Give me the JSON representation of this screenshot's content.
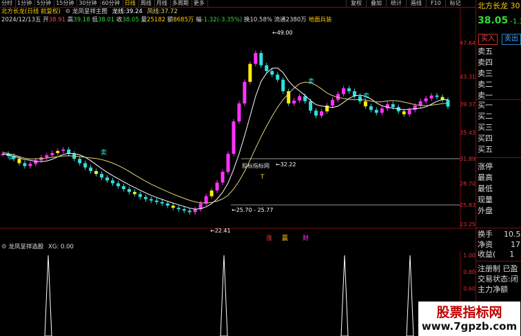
{
  "toolbar": {
    "periods": [
      "分时",
      "1分钟",
      "5分钟",
      "15分钟",
      "30分钟",
      "60分钟",
      "日线",
      "周线",
      "月线",
      "多周期",
      "更多"
    ],
    "active_index": 6,
    "right_buttons": [
      "复权",
      "叠加",
      "统计",
      "画线",
      "F10",
      "标记"
    ]
  },
  "header": {
    "title_line": "北方长龙(日线 前复权)",
    "indicator_name": "龙凤呈祥主图",
    "long_line_label": "龙线:",
    "long_line_value": "39.24",
    "phoenix_label": "凤线:",
    "phoenix_value": "37.72",
    "date": "2024/12/13五",
    "open_label": "开",
    "open_value": "38.91",
    "high_label": "高",
    "high_value": "39.18",
    "low_label": "低",
    "low_value": "38.01",
    "close_label": "收",
    "close_value": "38.05",
    "volume_label": "量",
    "volume_value": "25182",
    "amount_label": "额",
    "amount_value": "8685万",
    "change_label": "幅",
    "change_value": "-1.32(-3.35%)",
    "turnover_label": "换",
    "turnover_value": "10.58%",
    "float_label": "流通",
    "float_value": "2380万",
    "tag": "地面兵装"
  },
  "price_axis": {
    "ticks": [
      "47.64",
      "43.31",
      "39.37",
      "35.43",
      "31.89",
      "28.70",
      "25.83",
      "23.25"
    ],
    "lower_ticks": [
      "1.00",
      "0.80",
      "0.60",
      "0.40",
      "0.20"
    ]
  },
  "annotations": {
    "high_price": "49.00",
    "level_1": "32.22",
    "level_2": "25.70 - 25.77",
    "low_price": "22.41",
    "sell_labels": [
      "卖",
      "卖",
      "卖",
      "卖"
    ],
    "brand_label": "股标指标网",
    "T_mark": "T",
    "bottom_marks": [
      "涨",
      "赢",
      "财"
    ]
  },
  "lower_panel": {
    "title": "龙凤呈祥选股",
    "xg_label": "XG:",
    "xg_value": "0.00"
  },
  "right_panel": {
    "stock_name": "北方长龙",
    "stock_code": "30",
    "price": "38.05",
    "change": "-1.32",
    "buy_button": "买入",
    "sell_button": "卖出",
    "ask_labels": [
      "卖五",
      "卖四",
      "卖三",
      "卖二",
      "卖一"
    ],
    "bid_labels": [
      "买一",
      "买二",
      "买三",
      "买四",
      "买五"
    ],
    "stats_labels": [
      "涨停",
      "最高",
      "最低",
      "现量",
      "外盘"
    ],
    "turnover_label": "换手",
    "turnover_value": "10.5",
    "nav_label": "净资",
    "nav_value": "17",
    "eps_label": "收益(",
    "eps_value": "1",
    "reg_label": "注册制",
    "reg_value": "已盈",
    "trade_label": "交易状态:",
    "trade_value": "闭",
    "capital_label": "主力净额"
  },
  "watermark": {
    "line1": "股票指标网",
    "line2": "www.7gpzb.com"
  },
  "colors": {
    "up": "#ff33ff",
    "down": "#33dddd",
    "yellow": "#ffee00",
    "axis_red": "#e23030",
    "long_line": "#ffffff",
    "phoenix_line": "#e6d27a"
  },
  "chart_data": {
    "type": "candlestick",
    "close_series": [
      31.5,
      31.2,
      30.8,
      30.2,
      29.8,
      30.1,
      30.6,
      31.0,
      31.3,
      31.6,
      31.9,
      32.1,
      31.5,
      30.8,
      30.2,
      29.6,
      29.1,
      28.7,
      28.2,
      27.8,
      27.4,
      27.0,
      26.6,
      26.2,
      25.9,
      25.5,
      25.2,
      25.0,
      24.8,
      24.6,
      24.3,
      24.0,
      23.8,
      23.6,
      23.4,
      23.8,
      24.6,
      25.6,
      26.4,
      27.5,
      29.0,
      31.5,
      36.0,
      38.5,
      41.5,
      44.0,
      45.5,
      43.8,
      43.0,
      42.5,
      41.8,
      40.2,
      38.5,
      38.9,
      39.5,
      38.8,
      37.5,
      36.8,
      37.4,
      38.2,
      39.0,
      39.8,
      40.6,
      40.2,
      39.5,
      38.8,
      38.1,
      37.6,
      37.2,
      37.8,
      38.4,
      38.0,
      37.4,
      37.0,
      37.6,
      38.2,
      38.8,
      39.2,
      39.6,
      39.4,
      39.0,
      38.05
    ],
    "ylim": [
      22.0,
      50.0
    ]
  }
}
